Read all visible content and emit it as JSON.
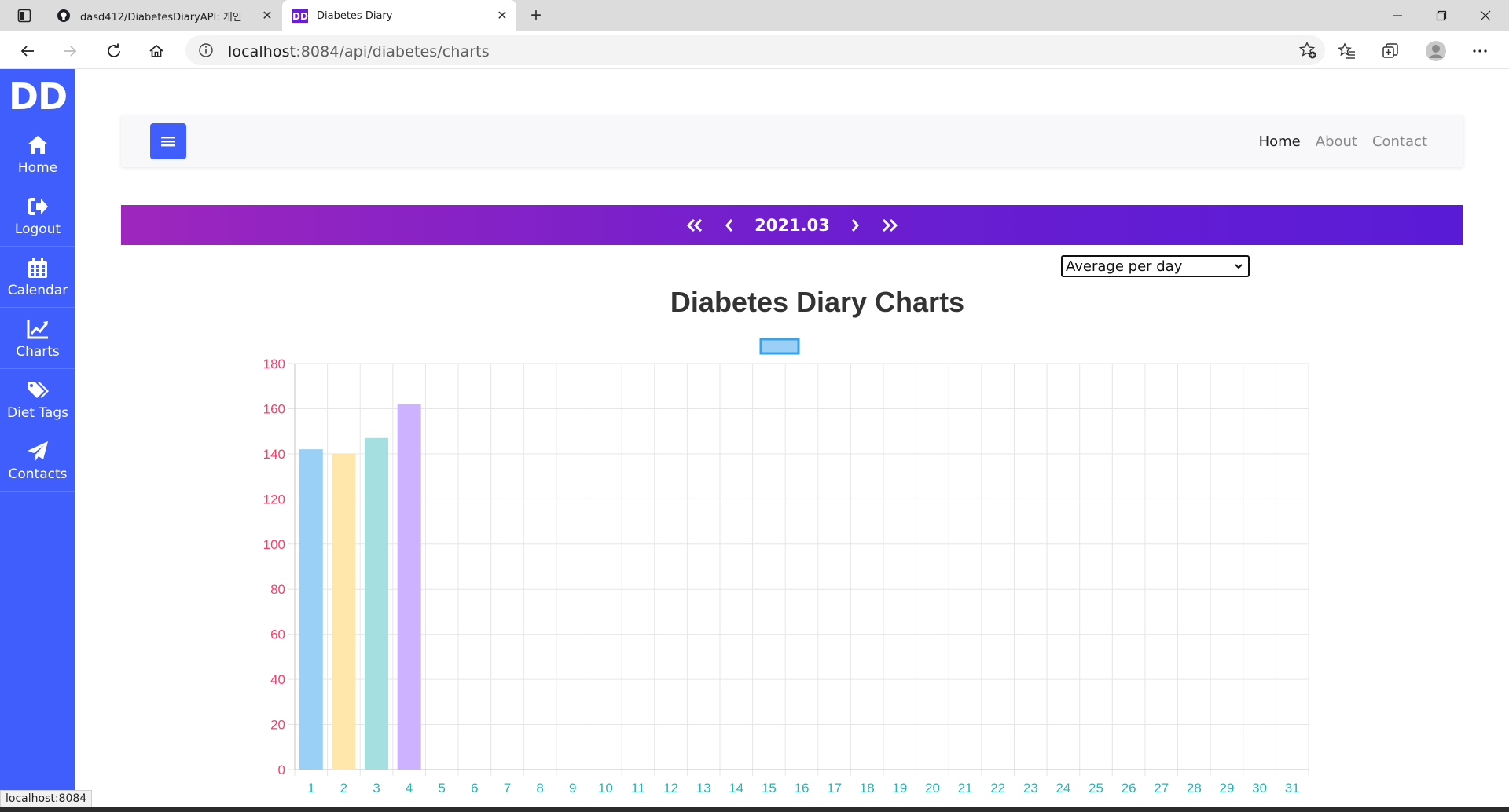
{
  "browser": {
    "tabs": [
      {
        "title": "dasd412/DiabetesDiaryAPI: 개인",
        "favicon": "github-icon"
      },
      {
        "title": "Diabetes Diary",
        "favicon": "dd-icon",
        "active": true
      }
    ],
    "url_host": "localhost",
    "url_rest": ":8084/api/diabetes/charts",
    "status_text": "localhost:8084"
  },
  "sidebar": {
    "brand": "DD",
    "items": [
      {
        "label": "Home",
        "icon": "home-icon"
      },
      {
        "label": "Logout",
        "icon": "logout-icon"
      },
      {
        "label": "Calendar",
        "icon": "calendar-icon"
      },
      {
        "label": "Charts",
        "icon": "chart-line-icon"
      },
      {
        "label": "Diet Tags",
        "icon": "tags-icon"
      },
      {
        "label": "Contacts",
        "icon": "paper-plane-icon"
      }
    ]
  },
  "topnav": {
    "links": [
      "Home",
      "About",
      "Contact"
    ]
  },
  "month_nav": {
    "label": "2021.03"
  },
  "mode_select": {
    "selected": "Average per day"
  },
  "chart_data": {
    "type": "bar",
    "title": "Diabetes Diary Charts",
    "categories": [
      "1",
      "2",
      "3",
      "4",
      "5",
      "6",
      "7",
      "8",
      "9",
      "10",
      "11",
      "12",
      "13",
      "14",
      "15",
      "16",
      "17",
      "18",
      "19",
      "20",
      "21",
      "22",
      "23",
      "24",
      "25",
      "26",
      "27",
      "28",
      "29",
      "30",
      "31"
    ],
    "values": [
      142,
      140,
      147,
      162
    ],
    "ylim": [
      0,
      180
    ],
    "yticks": [
      0,
      20,
      40,
      60,
      80,
      100,
      120,
      140,
      160,
      180
    ],
    "legend_placement": "top-center",
    "grid": true,
    "bar_colors": [
      "#9ad0f5",
      "#ffe6aa",
      "#a5dfdf",
      "#ccb2ff"
    ],
    "bar_borders": [
      "#36a2eb",
      "#ffcd56",
      "#4bc0c0",
      "#9966ff"
    ],
    "tick_color_y": "#ff3b6b",
    "tick_color_x": "#29b3b3"
  }
}
